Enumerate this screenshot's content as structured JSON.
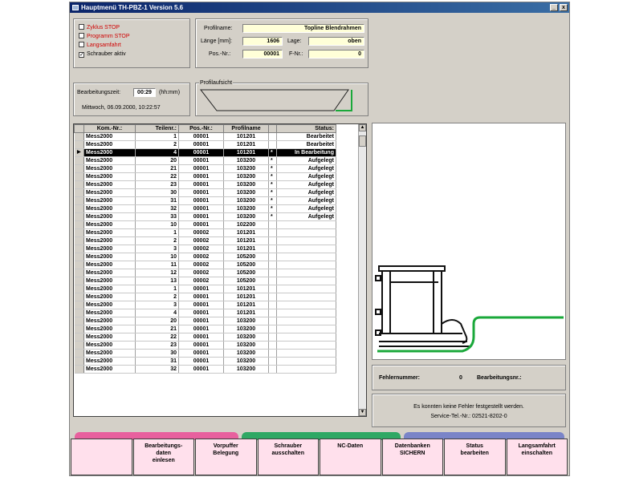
{
  "window": {
    "title": "Hauptmenü TH-PBZ-1 Version 5.6",
    "min": "_",
    "close": "x"
  },
  "checkboxes": [
    {
      "label": "Zyklus STOP",
      "checked": false,
      "red": true
    },
    {
      "label": "Programm STOP",
      "checked": false,
      "red": true
    },
    {
      "label": "Langsamfahrt",
      "checked": false,
      "red": true
    },
    {
      "label": "Schrauber aktiv",
      "checked": true,
      "red": false
    }
  ],
  "profile": {
    "name_label": "Profilname:",
    "name_value": "Topline Blendrahmen",
    "length_label": "Länge [mm]:",
    "length_value": "1606",
    "pos_label": "Pos.-Nr.:",
    "pos_value": "00001",
    "lage_label": "Lage:",
    "lage_value": "oben",
    "fnr_label": "F-Nr.:",
    "fnr_value": "0"
  },
  "time": {
    "label": "Bearbeitungszeit:",
    "value": "00:29",
    "unit": "(hh:mm)",
    "datetime": "Mittwoch, 06.09.2000, 10:22:57"
  },
  "profilaufsicht": {
    "label": "Profilaufsicht"
  },
  "table": {
    "headers": [
      "Kom.-Nr.:",
      "Teilenr.:",
      "Pos.-Nr.:",
      "Profilname",
      "",
      "Status:"
    ],
    "rows": [
      [
        "Mess2000",
        "1",
        "00001",
        "101201",
        "",
        "Bearbeitet"
      ],
      [
        "Mess2000",
        "2",
        "00001",
        "101201",
        "",
        "Bearbeitet"
      ],
      [
        "Mess2000",
        "4",
        "00001",
        "101201",
        "*",
        "In Bearbeitung"
      ],
      [
        "Mess2000",
        "20",
        "00001",
        "103200",
        "*",
        "Aufgelegt"
      ],
      [
        "Mess2000",
        "21",
        "00001",
        "103200",
        "*",
        "Aufgelegt"
      ],
      [
        "Mess2000",
        "22",
        "00001",
        "103200",
        "*",
        "Aufgelegt"
      ],
      [
        "Mess2000",
        "23",
        "00001",
        "103200",
        "*",
        "Aufgelegt"
      ],
      [
        "Mess2000",
        "30",
        "00001",
        "103200",
        "*",
        "Aufgelegt"
      ],
      [
        "Mess2000",
        "31",
        "00001",
        "103200",
        "*",
        "Aufgelegt"
      ],
      [
        "Mess2000",
        "32",
        "00001",
        "103200",
        "*",
        "Aufgelegt"
      ],
      [
        "Mess2000",
        "33",
        "00001",
        "103200",
        "*",
        "Aufgelegt"
      ],
      [
        "Mess2000",
        "10",
        "00001",
        "102200",
        "",
        ""
      ],
      [
        "Mess2000",
        "1",
        "00002",
        "101201",
        "",
        ""
      ],
      [
        "Mess2000",
        "2",
        "00002",
        "101201",
        "",
        ""
      ],
      [
        "Mess2000",
        "3",
        "00002",
        "101201",
        "",
        ""
      ],
      [
        "Mess2000",
        "10",
        "00002",
        "105200",
        "",
        ""
      ],
      [
        "Mess2000",
        "11",
        "00002",
        "105200",
        "",
        ""
      ],
      [
        "Mess2000",
        "12",
        "00002",
        "105200",
        "",
        ""
      ],
      [
        "Mess2000",
        "13",
        "00002",
        "105200",
        "",
        ""
      ],
      [
        "Mess2000",
        "1",
        "00001",
        "101201",
        "",
        ""
      ],
      [
        "Mess2000",
        "2",
        "00001",
        "101201",
        "",
        ""
      ],
      [
        "Mess2000",
        "3",
        "00001",
        "101201",
        "",
        ""
      ],
      [
        "Mess2000",
        "4",
        "00001",
        "101201",
        "",
        ""
      ],
      [
        "Mess2000",
        "20",
        "00001",
        "103200",
        "",
        ""
      ],
      [
        "Mess2000",
        "21",
        "00001",
        "103200",
        "",
        ""
      ],
      [
        "Mess2000",
        "22",
        "00001",
        "103200",
        "",
        ""
      ],
      [
        "Mess2000",
        "23",
        "00001",
        "103200",
        "",
        ""
      ],
      [
        "Mess2000",
        "30",
        "00001",
        "103200",
        "",
        ""
      ],
      [
        "Mess2000",
        "31",
        "00001",
        "103200",
        "",
        ""
      ],
      [
        "Mess2000",
        "32",
        "00001",
        "103200",
        "",
        ""
      ]
    ],
    "selected_index": 2
  },
  "status": {
    "fehler_label": "Fehlernummer:",
    "fehler_value": "0",
    "bearb_label": "Bearbeitungsnr.:",
    "message": "Es konnten keine Fehler festgestellt werden.",
    "service": "Service-Tel.-Nr.: 02521-8202-0"
  },
  "buttons": [
    "",
    "Bearbeitungs-\ndaten\neinlesen",
    "Vorpuffer\nBelegung",
    "Schrauber\nausschalten",
    "NC-Daten",
    "Datenbanken\nSICHERN",
    "Status\nbearbeiten",
    "Langsamfahrt\neinschalten"
  ],
  "colors": {
    "accent_green": "#1aa83a",
    "tab_pink": "#e8609e",
    "tab_green": "#2ea864",
    "tab_blue": "#7a84c8",
    "field_yellow": "#ffffd8"
  }
}
